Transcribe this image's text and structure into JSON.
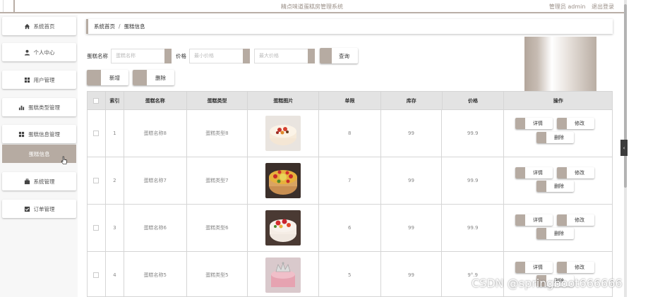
{
  "app": {
    "title": "精点味道蛋糕房管理系统",
    "user_label": "管理员 admin",
    "logout": "退出登录"
  },
  "sidebar": {
    "items": [
      {
        "label": "系统首页",
        "icon": "home-icon"
      },
      {
        "label": "个人中心",
        "icon": "user-icon"
      },
      {
        "label": "用户管理",
        "icon": "grid-icon"
      },
      {
        "label": "蛋糕类型管理",
        "icon": "bar-chart-icon"
      },
      {
        "label": "蛋糕信息管理",
        "icon": "grid-icon"
      },
      {
        "label": "蛋糕信息",
        "icon": "",
        "active": true
      },
      {
        "label": "系统管理",
        "icon": "briefcase-icon"
      },
      {
        "label": "订单管理",
        "icon": "checkbox-icon"
      }
    ]
  },
  "breadcrumb": {
    "home": "系统首页",
    "separator": "/",
    "current": "蛋糕信息"
  },
  "search": {
    "name_label": "蛋糕名称",
    "name_placeholder": "蛋糕名称",
    "price_label": "价格",
    "min_placeholder": "最小价格",
    "max_placeholder": "最大价格",
    "search_button": "查询"
  },
  "actions": {
    "add": "新增",
    "delete": "删除"
  },
  "table": {
    "headers": [
      "",
      "索引",
      "蛋糕名称",
      "蛋糕类型",
      "蛋糕图片",
      "单限",
      "库存",
      "价格",
      "操作"
    ],
    "rows": [
      {
        "index": "1",
        "name": "蛋糕名称8",
        "type": "蛋糕类型8",
        "limit": "8",
        "stock": "99",
        "price": "99.9"
      },
      {
        "index": "2",
        "name": "蛋糕名称7",
        "type": "蛋糕类型7",
        "limit": "7",
        "stock": "99",
        "price": "99.9"
      },
      {
        "index": "3",
        "name": "蛋糕名称6",
        "type": "蛋糕类型6",
        "limit": "6",
        "stock": "99",
        "price": "99.9"
      },
      {
        "index": "4",
        "name": "蛋糕名称5",
        "type": "蛋糕类型5",
        "limit": "5",
        "stock": "99",
        "price": "9°.9"
      }
    ],
    "row_actions": {
      "detail": "详情",
      "edit": "修改",
      "delete": "删除"
    }
  },
  "watermark": "CSDN @springboot666666",
  "colors": {
    "accent": "#b6aba2",
    "header_bg": "#e3e3e3"
  }
}
